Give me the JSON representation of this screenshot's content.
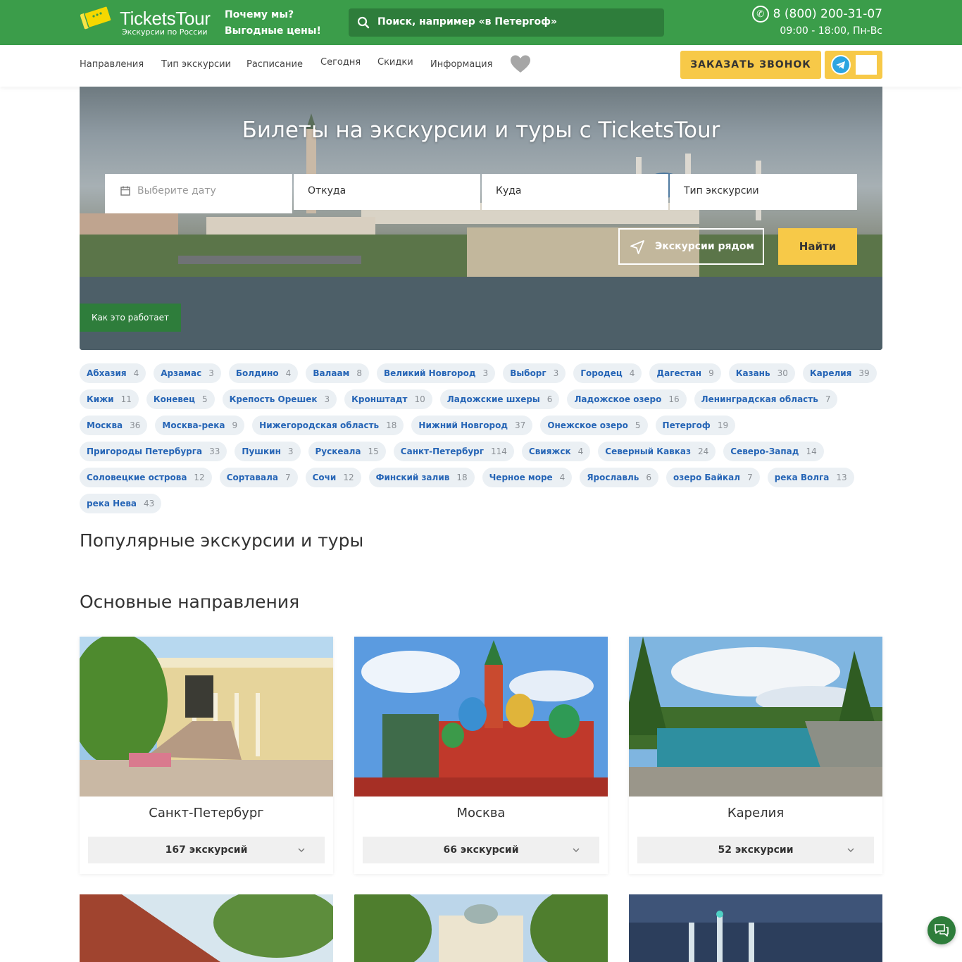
{
  "header": {
    "logo_title": "TicketsTour",
    "logo_subtitle": "Экскурсии по России",
    "why_line1": "Почему мы?",
    "why_line2": "Выгодные цены!",
    "search_placeholder": "Поиск, например «в Петергоф»",
    "phone": "8 (800) 200-31-07",
    "hours": "09:00 - 18:00, Пн-Вс"
  },
  "nav": {
    "items": [
      "Направления",
      "Тип экскурсии",
      "Расписание",
      "Сегодня",
      "Скидки",
      "Информация"
    ],
    "call_button": "ЗАКАЗАТЬ ЗВОНОК"
  },
  "hero": {
    "title": "Билеты на экскурсии и туры с TicketsTour",
    "date_placeholder": "Выберите дату",
    "from_label": "Откуда",
    "to_label": "Куда",
    "type_label": "Тип экскурсии",
    "near_button": "Экскурсии рядом",
    "find_button": "Найти",
    "how_button": "Как это работает"
  },
  "tags": [
    {
      "name": "Абхазия",
      "count": "4"
    },
    {
      "name": "Арзамас",
      "count": "3"
    },
    {
      "name": "Болдино",
      "count": "4"
    },
    {
      "name": "Валаам",
      "count": "8"
    },
    {
      "name": "Великий Новгород",
      "count": "3"
    },
    {
      "name": "Выборг",
      "count": "3"
    },
    {
      "name": "Городец",
      "count": "4"
    },
    {
      "name": "Дагестан",
      "count": "9"
    },
    {
      "name": "Казань",
      "count": "30"
    },
    {
      "name": "Карелия",
      "count": "39"
    },
    {
      "name": "Кижи",
      "count": "11"
    },
    {
      "name": "Коневец",
      "count": "5"
    },
    {
      "name": "Крепость Орешек",
      "count": "3"
    },
    {
      "name": "Кронштадт",
      "count": "10"
    },
    {
      "name": "Ладожские шхеры",
      "count": "6"
    },
    {
      "name": "Ладожское озеро",
      "count": "16"
    },
    {
      "name": "Ленинградская область",
      "count": "7"
    },
    {
      "name": "Москва",
      "count": "36"
    },
    {
      "name": "Москва-река",
      "count": "9"
    },
    {
      "name": "Нижегородская область",
      "count": "18"
    },
    {
      "name": "Нижний Новгород",
      "count": "37"
    },
    {
      "name": "Онежское озеро",
      "count": "5"
    },
    {
      "name": "Петергоф",
      "count": "19"
    },
    {
      "name": "Пригороды Петербурга",
      "count": "33"
    },
    {
      "name": "Пушкин",
      "count": "3"
    },
    {
      "name": "Рускеала",
      "count": "15"
    },
    {
      "name": "Санкт-Петербург",
      "count": "114"
    },
    {
      "name": "Свияжск",
      "count": "4"
    },
    {
      "name": "Северный Кавказ",
      "count": "24"
    },
    {
      "name": "Северо-Запад",
      "count": "14"
    },
    {
      "name": "Соловецкие острова",
      "count": "12"
    },
    {
      "name": "Сортавала",
      "count": "7"
    },
    {
      "name": "Сочи",
      "count": "12"
    },
    {
      "name": "Финский залив",
      "count": "18"
    },
    {
      "name": "Черное море",
      "count": "4"
    },
    {
      "name": "Ярославль",
      "count": "6"
    },
    {
      "name": "озеро Байкал",
      "count": "7"
    },
    {
      "name": "река Волга",
      "count": "13"
    },
    {
      "name": "река Нева",
      "count": "43"
    }
  ],
  "sections": {
    "popular_title": "Популярные экскурсии и туры",
    "main_title": "Основные направления"
  },
  "cards": [
    {
      "title": "Санкт-Петербург",
      "count": "167 экскурсий"
    },
    {
      "title": "Москва",
      "count": "66 экскурсий"
    },
    {
      "title": "Карелия",
      "count": "52 экскурсии"
    }
  ],
  "colors": {
    "brand_green": "#3b9d4a",
    "dark_green": "#2e7d3b",
    "accent_yellow": "#f7c948",
    "tag_blue": "#2665b6"
  }
}
